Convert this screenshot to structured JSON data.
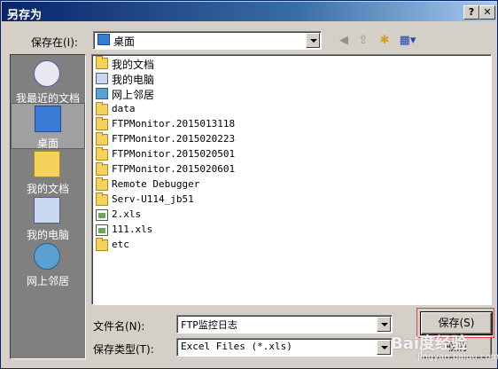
{
  "window": {
    "title": "另存为",
    "help": "?",
    "close": "✕"
  },
  "location": {
    "label": "保存在(I):",
    "value": "桌面"
  },
  "toolbar": {
    "back": "◀",
    "up": "⇧",
    "new_folder": "✱",
    "views": "▦▾"
  },
  "places": [
    {
      "label": "我最近的文档",
      "icon": "recent-docs-icon"
    },
    {
      "label": "桌面",
      "icon": "desktop-icon"
    },
    {
      "label": "我的文档",
      "icon": "my-documents-icon"
    },
    {
      "label": "我的电脑",
      "icon": "my-computer-icon"
    },
    {
      "label": "网上邻居",
      "icon": "network-icon"
    }
  ],
  "files": [
    {
      "name": "我的文档",
      "type": "folder"
    },
    {
      "name": "我的电脑",
      "type": "computer"
    },
    {
      "name": "网上邻居",
      "type": "network"
    },
    {
      "name": "data",
      "type": "folder"
    },
    {
      "name": "FTPMonitor.2015013118",
      "type": "folder"
    },
    {
      "name": "FTPMonitor.2015020223",
      "type": "folder"
    },
    {
      "name": "FTPMonitor.2015020501",
      "type": "folder"
    },
    {
      "name": "FTPMonitor.2015020601",
      "type": "folder"
    },
    {
      "name": "Remote Debugger",
      "type": "folder"
    },
    {
      "name": "Serv-U114_jb51",
      "type": "folder"
    },
    {
      "name": "2.xls",
      "type": "xls"
    },
    {
      "name": "111.xls",
      "type": "xls"
    },
    {
      "name": "etc",
      "type": "folder"
    }
  ],
  "filename": {
    "label": "文件名(N):",
    "value": "FTP监控日志"
  },
  "filetype": {
    "label": "保存类型(T):",
    "value": "Excel Files (*.xls)"
  },
  "buttons": {
    "save": "保存(S)",
    "cancel": "取消"
  },
  "watermark": {
    "main": "Bai度经验",
    "sub": "jingyan.baidu.com"
  },
  "colors": {
    "titlebar": "#0a246a",
    "dialog": "#d4d0c8",
    "highlight": "#e04040"
  }
}
